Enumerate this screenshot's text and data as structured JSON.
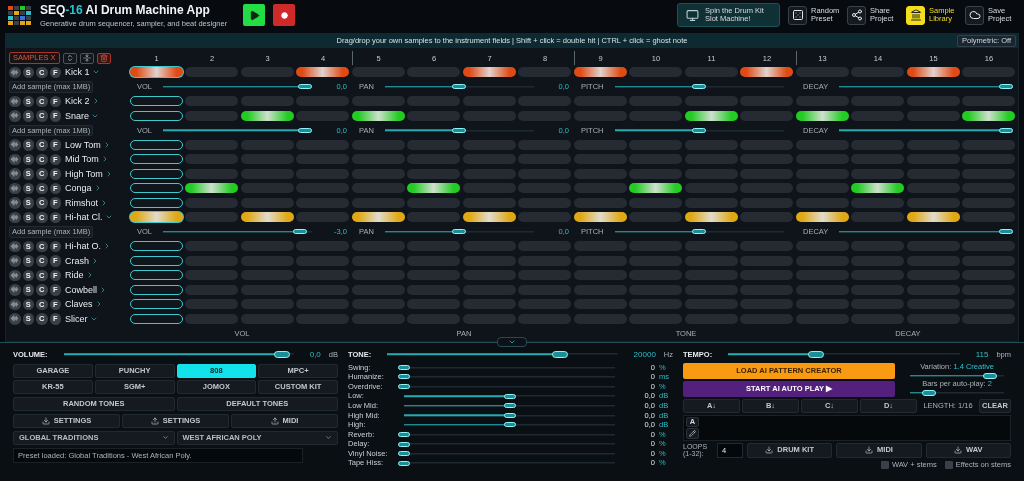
{
  "title": {
    "brand": "SEQ",
    "version": "-16",
    "name": "AI Drum Machine App"
  },
  "subtitle": "Generative drum sequencer, sampler, and beat designer",
  "toolbar": [
    {
      "kind": "slot",
      "label": "Spin the Drum Kit Slot Machine!",
      "active": false
    },
    {
      "kind": "dice",
      "label": "Random Preset",
      "active": false
    },
    {
      "kind": "share",
      "label": "Share Project",
      "active": false
    },
    {
      "kind": "library",
      "label": "Sample Library",
      "active": true
    },
    {
      "kind": "cloud",
      "label": "Save Project",
      "active": false
    }
  ],
  "hint": "Drag/drop your own samples to the instrument fields | Shift + click = double hit | CTRL + click = ghost note",
  "polymetric": "Polymetric: Off",
  "samples_button": "SAMPLES X",
  "steps": [
    {
      "label": "1",
      "current": true
    },
    {
      "label": "2",
      "current": false
    },
    {
      "label": "3",
      "current": false
    },
    {
      "label": "4",
      "current": false
    },
    {
      "label": "5",
      "current": false
    },
    {
      "label": "6",
      "current": false
    },
    {
      "label": "7",
      "current": false
    },
    {
      "label": "8",
      "current": false
    },
    {
      "label": "9",
      "current": false
    },
    {
      "label": "10",
      "current": false
    },
    {
      "label": "11",
      "current": false
    },
    {
      "label": "12",
      "current": false
    },
    {
      "label": "13",
      "current": false
    },
    {
      "label": "14",
      "current": false
    },
    {
      "label": "15",
      "current": false
    },
    {
      "label": "16",
      "current": false
    }
  ],
  "tracks": [
    {
      "name": "Kick 1",
      "expanded": true,
      "color": "#e04a14",
      "toggles": [
        "S",
        "C",
        "F"
      ],
      "pattern": [
        true,
        false,
        false,
        true,
        false,
        false,
        true,
        false,
        true,
        false,
        false,
        true,
        false,
        false,
        true,
        false
      ],
      "sample_button": "Add sample (max 1MB)",
      "params": [
        {
          "label": "VOL",
          "level": 0.95,
          "value": "0,0"
        },
        {
          "label": "PAN",
          "level": 0.5,
          "value": "0,0"
        },
        {
          "label": "PITCH",
          "level": 0.5
        },
        {
          "label": "DECAY",
          "level": 1
        }
      ]
    },
    {
      "name": "Kick 2",
      "expanded": false,
      "toggles": [
        "S",
        "C",
        "F"
      ],
      "pattern": [
        false,
        false,
        false,
        false,
        false,
        false,
        false,
        false,
        false,
        false,
        false,
        false,
        false,
        false,
        false,
        false
      ]
    },
    {
      "name": "Snare",
      "expanded": true,
      "color": "#22cc22",
      "toggles": [
        "S",
        "C",
        "F"
      ],
      "pattern": [
        false,
        false,
        true,
        false,
        true,
        false,
        false,
        false,
        false,
        false,
        true,
        false,
        true,
        false,
        false,
        true
      ],
      "sample_button": "Add sample (max 1MB)",
      "params": [
        {
          "label": "VOL",
          "level": 0.95,
          "value": "0,0"
        },
        {
          "label": "PAN",
          "level": 0.5,
          "value": "0,0"
        },
        {
          "label": "PITCH",
          "level": 0.5
        },
        {
          "label": "DECAY",
          "level": 1
        }
      ]
    },
    {
      "name": "Low Tom",
      "expanded": false,
      "toggles": [
        "S",
        "C",
        "F"
      ],
      "pattern": [
        false,
        false,
        false,
        false,
        false,
        false,
        false,
        false,
        false,
        false,
        false,
        false,
        false,
        false,
        false,
        false
      ]
    },
    {
      "name": "Mid Tom",
      "expanded": false,
      "toggles": [
        "S",
        "C",
        "F"
      ],
      "pattern": [
        false,
        false,
        false,
        false,
        false,
        false,
        false,
        false,
        false,
        false,
        false,
        false,
        false,
        false,
        false,
        false
      ]
    },
    {
      "name": "High Tom",
      "expanded": false,
      "toggles": [
        "S",
        "C",
        "F"
      ],
      "pattern": [
        false,
        false,
        false,
        false,
        false,
        false,
        false,
        false,
        false,
        false,
        false,
        false,
        false,
        false,
        false,
        false
      ]
    },
    {
      "name": "Conga",
      "expanded": false,
      "color": "#22cc22",
      "toggles": [
        "S",
        "C",
        "F"
      ],
      "pattern": [
        false,
        true,
        false,
        false,
        false,
        true,
        false,
        false,
        false,
        true,
        false,
        false,
        false,
        true,
        false,
        false
      ]
    },
    {
      "name": "Rimshot",
      "expanded": false,
      "toggles": [
        "S",
        "C",
        "F"
      ],
      "pattern": [
        false,
        false,
        false,
        false,
        false,
        false,
        false,
        false,
        false,
        false,
        false,
        false,
        false,
        false,
        false,
        false
      ]
    },
    {
      "name": "Hi-hat Cl.",
      "expanded": true,
      "color": "#e0a814",
      "toggles": [
        "S",
        "C",
        "F"
      ],
      "pattern": [
        true,
        false,
        true,
        false,
        true,
        false,
        true,
        false,
        true,
        false,
        true,
        false,
        true,
        false,
        true,
        false
      ],
      "sample_button": "Add sample (max 1MB)",
      "params": [
        {
          "label": "VOL",
          "level": 0.92,
          "value": "-3,0"
        },
        {
          "label": "PAN",
          "level": 0.5,
          "value": "0,0"
        },
        {
          "label": "PITCH",
          "level": 0.5
        },
        {
          "label": "DECAY",
          "level": 1
        }
      ]
    },
    {
      "name": "Hi-hat O.",
      "expanded": false,
      "toggles": [
        "S",
        "C",
        "F"
      ],
      "pattern": [
        false,
        false,
        false,
        false,
        false,
        false,
        false,
        false,
        false,
        false,
        false,
        false,
        false,
        false,
        false,
        false
      ]
    },
    {
      "name": "Crash",
      "expanded": false,
      "toggles": [
        "S",
        "C",
        "F"
      ],
      "pattern": [
        false,
        false,
        false,
        false,
        false,
        false,
        false,
        false,
        false,
        false,
        false,
        false,
        false,
        false,
        false,
        false
      ]
    },
    {
      "name": "Ride",
      "expanded": false,
      "toggles": [
        "S",
        "C",
        "F"
      ],
      "pattern": [
        false,
        false,
        false,
        false,
        false,
        false,
        false,
        false,
        false,
        false,
        false,
        false,
        false,
        false,
        false,
        false
      ]
    },
    {
      "name": "Cowbell",
      "expanded": false,
      "toggles": [
        "S",
        "C",
        "F"
      ],
      "pattern": [
        false,
        false,
        false,
        false,
        false,
        false,
        false,
        false,
        false,
        false,
        false,
        false,
        false,
        false,
        false,
        false
      ]
    },
    {
      "name": "Claves",
      "expanded": false,
      "toggles": [
        "S",
        "C",
        "F"
      ],
      "pattern": [
        false,
        false,
        false,
        false,
        false,
        false,
        false,
        false,
        false,
        false,
        false,
        false,
        false,
        false,
        false,
        false
      ]
    },
    {
      "name": "Slicer",
      "expanded": true,
      "toggles": [
        "S",
        "C",
        "F"
      ],
      "pattern": [
        false,
        false,
        false,
        false,
        false,
        false,
        false,
        false,
        false,
        false,
        false,
        false,
        false,
        false,
        false,
        false
      ],
      "params": [
        {
          "label": "VOL"
        },
        {
          "label": "PAN"
        },
        {
          "label": "TONE"
        },
        {
          "label": "DECAY"
        }
      ]
    }
  ],
  "volume": {
    "label": "VOLUME:",
    "level": 0.95,
    "value": "0,0",
    "unit": "dB"
  },
  "kits": [
    {
      "label": "GARAGE",
      "selected": false
    },
    {
      "label": "PUNCHY",
      "selected": false
    },
    {
      "label": "808",
      "selected": true
    },
    {
      "label": "MPC+",
      "selected": false
    },
    {
      "label": "KR-55",
      "selected": false
    },
    {
      "label": "SGM+",
      "selected": false
    },
    {
      "label": "JOMOX",
      "selected": false
    },
    {
      "label": "CUSTOM KIT",
      "selected": false
    }
  ],
  "tone_buttons": [
    "RANDOM TONES",
    "DEFAULT TONES"
  ],
  "file_buttons": [
    {
      "kind": "download",
      "label": "SETTINGS"
    },
    {
      "kind": "upload",
      "label": "SETTINGS"
    },
    {
      "kind": "upload",
      "label": "MIDI"
    }
  ],
  "preset_selects": [
    "GLOBAL TRADITIONS",
    "WEST AFRICAN POLY"
  ],
  "status": "Preset loaded: Global Traditions - West African Poly.",
  "tone": {
    "label": "TONE:",
    "level": 0.75,
    "value": "20000",
    "unit": "Hz"
  },
  "effects": [
    {
      "label": "Swing:",
      "level": 0,
      "value": "0",
      "unit": "%"
    },
    {
      "label": "Humanize:",
      "level": 0,
      "value": "0",
      "unit": "ms"
    },
    {
      "label": "Overdrive:",
      "level": 0,
      "value": "0",
      "unit": "%"
    },
    {
      "label": "Low:",
      "level": 0.5,
      "value": "0,0",
      "unit": "dB"
    },
    {
      "label": "Low Mid:",
      "level": 0.5,
      "value": "0,0",
      "unit": "dB"
    },
    {
      "label": "High Mid:",
      "level": 0.5,
      "value": "0,0",
      "unit": "dB"
    },
    {
      "label": "High:",
      "level": 0.5,
      "value": "0,0",
      "unit": "dB"
    },
    {
      "label": "Reverb:",
      "level": 0,
      "value": "0",
      "unit": "%"
    },
    {
      "label": "Delay:",
      "level": 0,
      "value": "0",
      "unit": "%"
    },
    {
      "label": "Vinyl Noise:",
      "level": 0,
      "value": "0",
      "unit": "%"
    },
    {
      "label": "Tape Hiss:",
      "level": 0,
      "value": "0",
      "unit": "%"
    }
  ],
  "tempo": {
    "label": "TEMPO:",
    "level": 0.38,
    "value": "115",
    "unit": "bpm"
  },
  "ai_buttons": [
    {
      "kind": "load",
      "label": "LOAD AI PATTERN CREATOR"
    },
    {
      "kind": "autoplay",
      "label": "START AI AUTO PLAY ▶"
    }
  ],
  "variation": {
    "label": "Variation:",
    "value": "1.4",
    "mode": "Creative",
    "level": 0.85
  },
  "bars": {
    "label": "Bars per auto-play:",
    "value": "2",
    "level": 0.2
  },
  "patterns": [
    "A↓",
    "B↓",
    "C↓",
    "D↓"
  ],
  "length": "LENGTH: 1/16",
  "clear": "CLEAR",
  "chain": [
    "A"
  ],
  "loops": {
    "label": "LOOPS (1-32):",
    "value": "4"
  },
  "exports": [
    "DRUM KIT",
    "MIDI",
    "WAV"
  ],
  "options": [
    {
      "label": "WAV + stems",
      "checked": false
    },
    {
      "label": "Effects on stems",
      "checked": false
    }
  ]
}
